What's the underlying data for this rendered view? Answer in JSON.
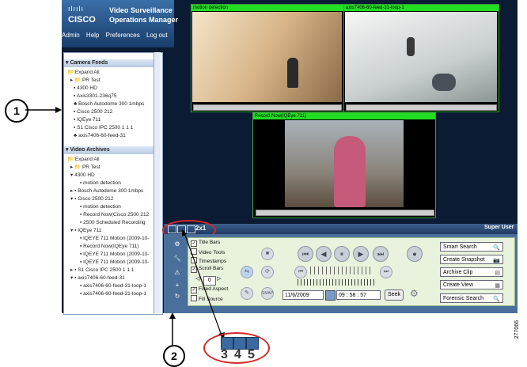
{
  "brand": {
    "logo_bars": "ılıılı",
    "logo_word": "CISCO",
    "title_line1": "Video Surveillance",
    "title_line2": "Operations Manager"
  },
  "menu": [
    "Admin",
    "Help",
    "Preferences",
    "Log out"
  ],
  "camera_feeds": {
    "header": "Camera Feeds",
    "items": [
      "Expand All",
      "PR Test",
      "4300 HD",
      "Axis3301-236q75",
      "Bosch Autodome 300 1mbps",
      "Cisco 2500 212",
      "IQEye 711",
      "S1 Cisco IPC 2500 1 1 1",
      "axis7406-60-feed-31"
    ]
  },
  "video_archives": {
    "header": "Video Archives",
    "items": [
      "Expand All",
      "PR Test",
      "4300 HD",
      "motion detection",
      "Bosch Autodome 300 1mbps",
      "Cisco 2500 212",
      "motion detection",
      "Record Now(Cisco 2500 212",
      "2500 Scheduled Recording",
      "IQEye 711",
      "IQEYE 711 Motion (2009-10-",
      "Record Now(IQEye 711)",
      "IQEYE 711 Motion (2009-10-",
      "IQEYE 711 Motion (2009-10-",
      "S1 Cisco IPC 2500 1 1 1",
      "axis7406-60-feed-31",
      "axis7406-60-feed-31-loop-1",
      "axis7406-60-feed-31-loop-1"
    ]
  },
  "videos": [
    {
      "title": "motion detection"
    },
    {
      "title": "axis7406-60-feed-31-loop-1"
    },
    {
      "title": "Record Now(IQEye 711)"
    }
  ],
  "layout": {
    "label": "2x1"
  },
  "user": {
    "label": "Super User"
  },
  "checkboxes": [
    {
      "label": "Title Bars",
      "checked": true
    },
    {
      "label": "Video Tools",
      "checked": false
    },
    {
      "label": "Timestamps",
      "checked": false
    },
    {
      "label": "Scroll Bars",
      "checked": true
    },
    {
      "label": "Fixed Aspect",
      "checked": true
    },
    {
      "label": "Fill Source",
      "checked": false
    }
  ],
  "stepper": {
    "value": "0"
  },
  "playback": {
    "date": "11/6/2009",
    "time": "09 : 58 : 57",
    "seek": "Seek",
    "smart_label": "SMAP"
  },
  "actions": [
    "Smart Search",
    "Create Snapshot",
    "Archive Clip",
    "Create View",
    "Forensic Search"
  ],
  "callouts": {
    "one": "1",
    "two": "2"
  },
  "zoom_numbers": [
    "3",
    "4",
    "5"
  ],
  "figure_number": "277066",
  "colors": {
    "accent": "#22dd22",
    "callout": "#d32a2a",
    "frame": "#0b1b33"
  }
}
